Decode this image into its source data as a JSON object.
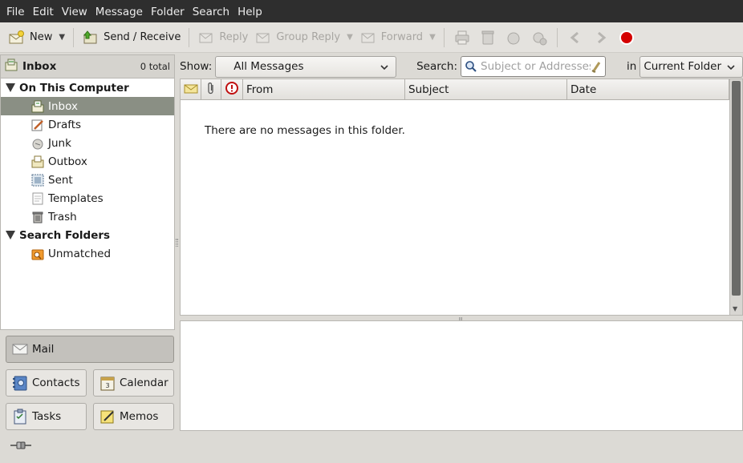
{
  "menu": [
    "File",
    "Edit",
    "View",
    "Message",
    "Folder",
    "Search",
    "Help"
  ],
  "toolbar": {
    "new_label": "New",
    "send_receive_label": "Send / Receive",
    "reply_label": "Reply",
    "group_reply_label": "Group Reply",
    "forward_label": "Forward"
  },
  "folder_header": {
    "title": "Inbox",
    "count": "0 total"
  },
  "tree": {
    "groups": [
      {
        "label": "On This Computer"
      },
      {
        "label": "Search Folders"
      }
    ],
    "local_folders": [
      {
        "label": "Inbox",
        "icon": "inbox-icon",
        "selected": true
      },
      {
        "label": "Drafts",
        "icon": "drafts-icon"
      },
      {
        "label": "Junk",
        "icon": "junk-icon"
      },
      {
        "label": "Outbox",
        "icon": "outbox-icon"
      },
      {
        "label": "Sent",
        "icon": "sent-icon"
      },
      {
        "label": "Templates",
        "icon": "templates-icon"
      },
      {
        "label": "Trash",
        "icon": "trash-icon"
      }
    ],
    "search_folders": [
      {
        "label": "Unmatched",
        "icon": "search-folder-icon"
      }
    ]
  },
  "switcher": {
    "mail": "Mail",
    "contacts": "Contacts",
    "calendar": "Calendar",
    "tasks": "Tasks",
    "memos": "Memos",
    "calendar_day": "3"
  },
  "filter": {
    "show_label": "Show:",
    "show_value": "All Messages",
    "search_label": "Search:",
    "search_placeholder": "Subject or Addresses",
    "in_label": "in",
    "scope_value": "Current Folder"
  },
  "columns": {
    "from": "From",
    "subject": "Subject",
    "date": "Date"
  },
  "empty_message": "There are no messages in this folder.",
  "colors": {
    "menubar_bg": "#2e2e2e",
    "selection": "#8a8f84",
    "stop_red": "#d40000"
  }
}
